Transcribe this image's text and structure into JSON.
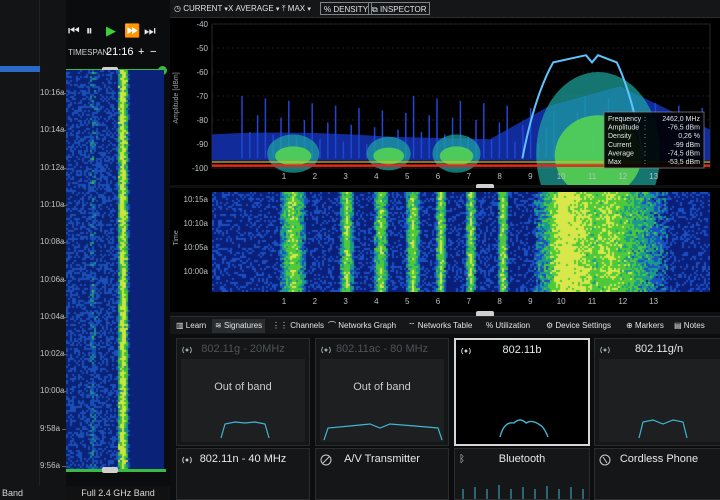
{
  "left_panel": {
    "footer": "Band"
  },
  "transport": {
    "timespan_label": "TIMESPAN",
    "timespan_value": "21:16",
    "plus": "+",
    "minus": "−"
  },
  "times": [
    "10:16a",
    "10:14a",
    "10:12a",
    "10:10a",
    "10:08a",
    "10:06a",
    "10:04a",
    "10:02a",
    "10:00a",
    "9:58a",
    "9:56a"
  ],
  "waterfall_footer": "Full 2.4 GHz Band",
  "toolbar": {
    "current": "CURRENT",
    "average": "AVERAGE",
    "max": "MAX",
    "density": "DENSITY",
    "inspector": "INSPECTOR"
  },
  "spectrum": {
    "ylabel": "Amplitude [dBm]",
    "yticks": [
      "-40",
      "-50",
      "-60",
      "-70",
      "-80",
      "-90",
      "-100"
    ],
    "xticks": [
      "1",
      "2",
      "3",
      "4",
      "5",
      "6",
      "7",
      "8",
      "9",
      "10",
      "11",
      "12",
      "13"
    ]
  },
  "inspector_readout": {
    "rows": [
      {
        "k": "Frequency",
        "v": "2462,0 MHz"
      },
      {
        "k": "Amplitude",
        "v": "-76,5 dBm"
      },
      {
        "k": "Density",
        "v": "0,26 %"
      },
      {
        "k": "Current",
        "v": "-99 dBm"
      },
      {
        "k": "Average",
        "v": "-74,5 dBm"
      },
      {
        "k": "Max",
        "v": "-53,5 dBm"
      }
    ]
  },
  "density": {
    "ylabel": "Time",
    "times": [
      "10:15a",
      "10:10a",
      "10:05a",
      "10:00a"
    ],
    "xticks": [
      "1",
      "2",
      "3",
      "4",
      "5",
      "6",
      "7",
      "8",
      "9",
      "10",
      "11",
      "12",
      "13"
    ]
  },
  "tabs": [
    {
      "label": "Learn"
    },
    {
      "label": "Signatures"
    },
    {
      "label": "Channels"
    },
    {
      "label": "Networks Graph"
    },
    {
      "label": "Networks Table"
    },
    {
      "label": "Utilization"
    },
    {
      "label": "Device Settings"
    },
    {
      "label": "Markers"
    },
    {
      "label": "Notes"
    }
  ],
  "cards": [
    {
      "title": "802.11g - 20MHz",
      "status": "Out of band"
    },
    {
      "title": "802.11ac - 80 MHz",
      "status": "Out of band"
    },
    {
      "title": "802.11b",
      "status": ""
    },
    {
      "title": "802.11g/n",
      "status": ""
    },
    {
      "title": "802.11n - 40 MHz",
      "status": ""
    },
    {
      "title": "A/V Transmitter",
      "status": ""
    },
    {
      "title": "Bluetooth",
      "status": ""
    },
    {
      "title": "Cordless Phone",
      "status": ""
    }
  ],
  "colors": {
    "accent_green": "#3bbb3b",
    "trace_cyan": "#5fc3ff",
    "sig_cyan": "#3fb7d4",
    "noise_red": "#e02a1e"
  }
}
